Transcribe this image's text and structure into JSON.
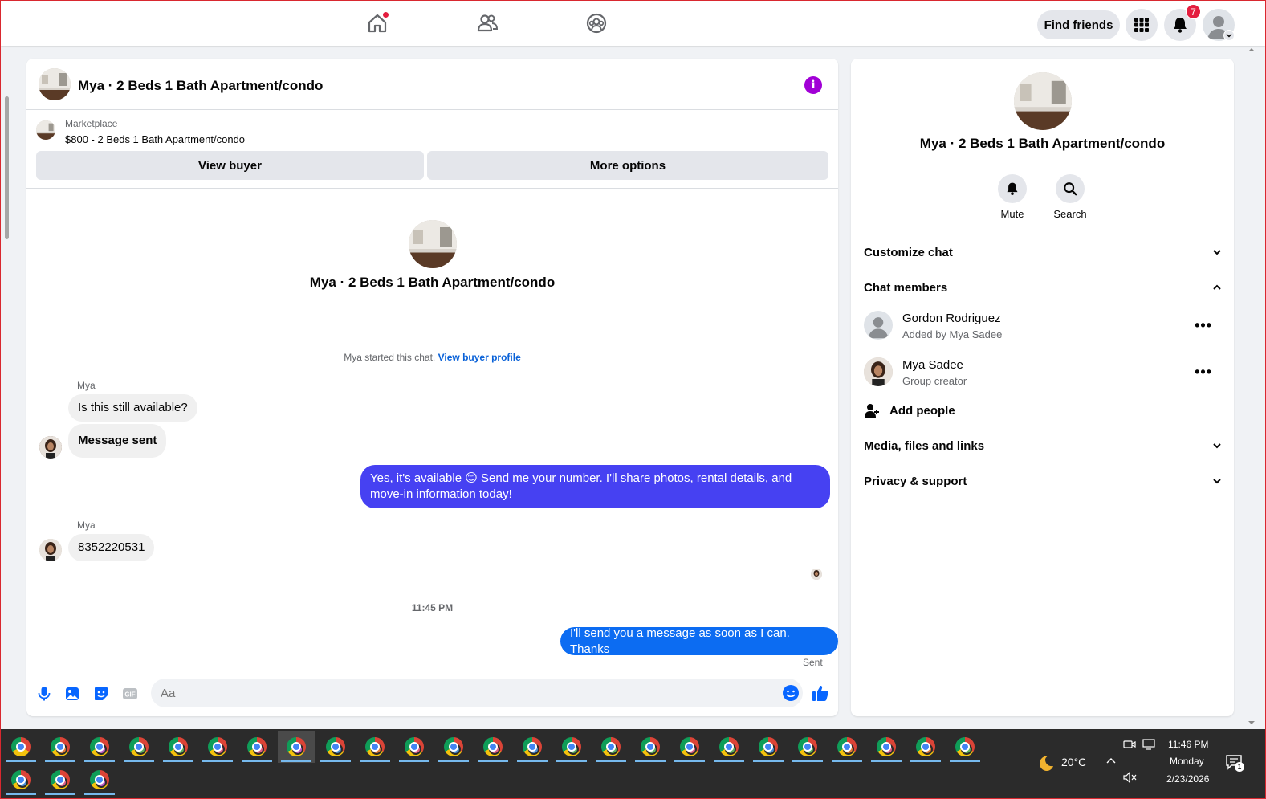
{
  "topbar": {
    "find_friends": "Find friends",
    "notification_count": "7",
    "icons": [
      "home-icon",
      "friends-icon",
      "groups-icon",
      "menu-grid-icon",
      "bell-icon"
    ]
  },
  "chat": {
    "title": "Mya · 2 Beds 1 Bath Apartment/condo",
    "marketplace_label": "Marketplace",
    "marketplace_listing": "$800 - 2 Beds 1 Bath Apartment/condo",
    "view_buyer": "View buyer",
    "more_options": "More options",
    "hero_name": "Mya · 2 Beds 1 Bath Apartment/condo",
    "started_text": "Mya started this chat.",
    "view_buyer_profile": "View buyer profile",
    "messages": [
      {
        "sender": "Mya",
        "text": "Is this still available?"
      },
      {
        "text": "Message sent"
      },
      {
        "text": "Yes, it's available 😊 Send me your number. I'll share photos, rental details, and move-in information today!"
      },
      {
        "sender": "Mya",
        "text": "8352220531"
      },
      {
        "text": "I'll send you a message as soon as I can. Thanks"
      }
    ],
    "timestamp": "11:45 PM",
    "sent_status": "Sent",
    "composer_placeholder": "Aa"
  },
  "sidebar": {
    "name": "Mya · 2 Beds 1 Bath Apartment/condo",
    "mute": "Mute",
    "search": "Search",
    "customize_chat": "Customize chat",
    "chat_members": "Chat members",
    "members": [
      {
        "name": "Gordon Rodriguez",
        "sub": "Added by Mya Sadee"
      },
      {
        "name": "Mya Sadee",
        "sub": "Group creator"
      }
    ],
    "add_people": "Add people",
    "media_files_links": "Media, files and links",
    "privacy_support": "Privacy & support"
  },
  "taskbar": {
    "weather": "20°C",
    "time": "11:46 PM",
    "day": "Monday",
    "date": "2/23/2026",
    "notification_count": "1"
  },
  "colors": {
    "accent_blue": "#0c6cf2",
    "accent_purple": "#4641f2",
    "info_purple": "#a100d6",
    "badge_red": "#e41e3f"
  }
}
